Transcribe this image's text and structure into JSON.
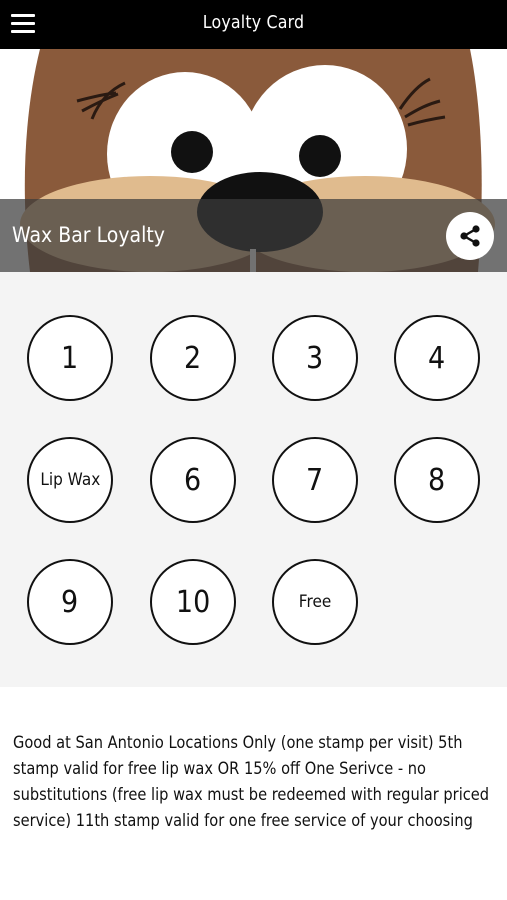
{
  "header": {
    "title": "Loyalty Card",
    "menu_icon": "hamburger-menu-icon"
  },
  "hero": {
    "title": "Wax Bar Loyalty",
    "share_icon": "share-icon",
    "image": "cartoon-beaver-face"
  },
  "stamps": [
    {
      "label": "1",
      "kind": "number"
    },
    {
      "label": "2",
      "kind": "number"
    },
    {
      "label": "3",
      "kind": "number"
    },
    {
      "label": "4",
      "kind": "number"
    },
    {
      "label": "Lip Wax",
      "kind": "reward"
    },
    {
      "label": "6",
      "kind": "number"
    },
    {
      "label": "7",
      "kind": "number"
    },
    {
      "label": "8",
      "kind": "number"
    },
    {
      "label": "9",
      "kind": "number"
    },
    {
      "label": "10",
      "kind": "number"
    },
    {
      "label": "Free",
      "kind": "reward"
    }
  ],
  "terms": "Good at San Antonio Locations Only (one stamp per visit) 5th stamp valid for free lip wax OR 15% off One Serivce - no substitutions (free lip wax must be redeemed with regular priced service) 11th stamp valid for one free service of your choosing",
  "colors": {
    "topbar": "#000000",
    "stamp_area_bg": "#f4f4f4",
    "beaver_fur": "#8a5a3b",
    "beaver_nose": "#111111"
  }
}
